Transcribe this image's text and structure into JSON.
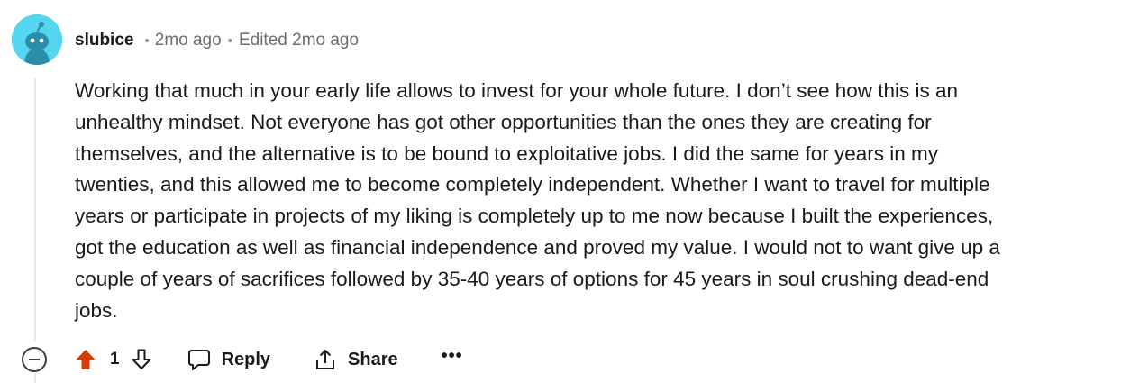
{
  "comment": {
    "author": "slubice",
    "separator": "•",
    "time": "2mo ago",
    "edited": "Edited 2mo ago",
    "avatar_icon": "reddit-snoo-avatar-icon",
    "avatar_color": "#54d6f0",
    "body_lines": [
      "Working that much in your early life allows to invest for your whole future. I don’t see how this is an",
      "unhealthy mindset. Not everyone has got other opportunities than the ones they are creating for",
      "themselves, and the alternative is to be bound to exploitative jobs. I did the same for years in my",
      "twenties, and this allowed me to become completely independent. Whether I want to travel for multiple",
      "years or participate in projects of my liking is completely up to me now because I built the experiences,",
      "got the education as well as financial independence and proved my value. I would not to want give up a",
      "couple of years of sacrifices followed by 35-40 years of options for 45 years in soul crushing dead-end",
      "jobs."
    ]
  },
  "actions": {
    "collapse_icon": "collapse-minus-icon",
    "upvote_icon": "upvote-arrow-icon",
    "upvote_color": "#d93a00",
    "score": "1",
    "downvote_icon": "downvote-arrow-icon",
    "reply_label": "Reply",
    "reply_icon": "speech-bubble-icon",
    "share_label": "Share",
    "share_icon": "share-upload-icon",
    "more_label": "•••",
    "more_icon": "more-ellipsis-icon"
  }
}
